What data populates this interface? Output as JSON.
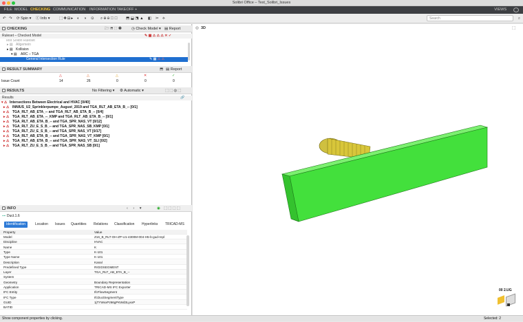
{
  "window": {
    "title": "Solibri Office – Test_Solibri_Issues"
  },
  "menu": {
    "items": [
      "FILE",
      "MODEL",
      "CHECKING",
      "COMMUNICATION",
      "INFORMATION TAKEOFF",
      "+"
    ],
    "active": "CHECKING",
    "views": "VIEWS"
  },
  "toolbar": {
    "spin": "Spin",
    "info": "Info",
    "search_placeholder": "Search"
  },
  "checking": {
    "title": "CHECKING",
    "check_model": "Check Model",
    "report": "Report",
    "ruleset_label": "Ruleset – Checked Model",
    "tree": [
      {
        "label": "Test Solibri Ruleset"
      },
      {
        "label": "Allgemein"
      },
      {
        "label": "Kollision"
      },
      {
        "label": "ARC – TGA"
      },
      {
        "label": "General Intersection Rule"
      }
    ]
  },
  "result_summary": {
    "title": "RESULT SUMMARY",
    "report": "Report",
    "row_label": "Issue Count",
    "counts": [
      "14",
      "26",
      "0",
      "0",
      "0"
    ]
  },
  "results": {
    "title": "RESULTS",
    "filter": "No Filtering",
    "mode": "Automatic",
    "header": "Results",
    "group": "Intersections Between Electrical and HVAC [0/40]",
    "items": [
      "INNIUS_U2_Sprinklerpumpe_August_2019 and TGA_RLT_AB_ETA_B_-- [0/1]",
      "TGA_RLT_AB_ETA_-- and TGA_RLT_AB_ETA_B_-- [0/4]",
      "TGA_RLT_AB_ETA_--_KMP and TGA_RLT_AB_ETA_B_-- [0/1]",
      "TGA_RLT_AB_ETA_B_-- and TGA_SPR_NAS_VT [0/12]",
      "TGA_RLT_ZU_E_S_B_-- and TGA_SPR_NAS_SB_KMP [0/1]",
      "TGA_RLT_ZU_E_S_B_-- and TGA_SPR_NAS_VT [0/17]",
      "TGA_RLT_AB_ETA_B_-- and TGA_SPR_NAS_VT_KMP [0/1]",
      "TGA_RLT_AB_ETA_B_-- and TGA_SPR_NAS_VT_SLI [0/2]",
      "TGA_RLT_ZU_E_S_B_-- and TGA_SPR_NAS_SB [0/1]"
    ]
  },
  "info": {
    "title": "INFO",
    "object": "Duct.1.6",
    "tabs": [
      "Identification",
      "Location",
      "Issues",
      "Quantities",
      "Relations",
      "Classification",
      "Hyperlinks",
      "TRICAD-MS"
    ],
    "active_tab": "Identification",
    "columns": [
      "Property",
      "Value"
    ],
    "rows": [
      [
        "Model",
        "Z16_B_RLT-OH-ZP-U1-4300M-004-H5-b-gud-repl"
      ],
      [
        "Discipline",
        "HVAC"
      ],
      [
        "Name",
        "K"
      ],
      [
        "Type",
        "K-101"
      ],
      [
        "Type Name",
        "K-101"
      ],
      [
        "Description",
        "Kanal"
      ],
      [
        "Predefined Type",
        "RIGIDSEGMENT"
      ],
      [
        "Layer",
        "TGA_RLT_AB_ETA_B_--"
      ],
      [
        "System",
        ""
      ],
      [
        "Geometry",
        "Boundary Representation"
      ],
      [
        "Application",
        "TRICAD-MS IFC Exporter"
      ],
      [
        "IFC Entity",
        "IfcFlowSegment"
      ],
      [
        "IFC Type",
        "IfcDuctSegmentType"
      ],
      [
        "GUID",
        "1jTYWxxPz66gPKWd3LyxxP"
      ],
      [
        "BATID",
        ""
      ]
    ]
  },
  "viewport": {
    "title": "3D",
    "compass": "00 2.UG"
  },
  "status": {
    "left": "Show component properties by clicking.",
    "right": "Selected: 2"
  },
  "colors": {
    "accent": "#f0c030",
    "selection": "#1f6fd0",
    "duct": "#43e03c",
    "pipe": "#d8c63a"
  }
}
